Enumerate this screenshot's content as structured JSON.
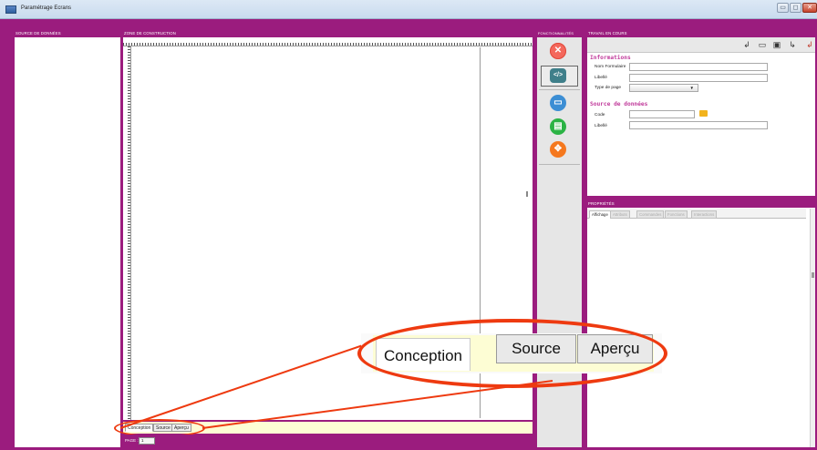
{
  "window": {
    "title": "Paramétrage Ecrans",
    "controls": {
      "minimize": "▭",
      "maximize": "◻",
      "close": "✕"
    }
  },
  "panels": {
    "source": {
      "header": "SOURCE DE DONNÉES"
    },
    "build": {
      "header": "ZONE DE CONSTRUCTION",
      "tabs": [
        "Conception",
        "Source",
        "Aperçu"
      ],
      "active_tab": "Conception",
      "page_label": "PAGE :",
      "page_value": "1"
    },
    "functions": {
      "header": "FONCTIONNALITÉS",
      "buttons": [
        {
          "name": "tools",
          "icon": "✕"
        },
        {
          "name": "code",
          "icon": "</>"
        },
        {
          "name": "screen",
          "icon": "▭"
        },
        {
          "name": "list",
          "icon": "▤"
        },
        {
          "name": "move",
          "icon": "✥"
        }
      ]
    },
    "work": {
      "header": "TRAVAIL EN COURS",
      "toolbar_icons": [
        "↲",
        "▭",
        "▣",
        "↳",
        "↲"
      ],
      "info_title": "Informations",
      "fields": {
        "nom_label": "Nom Formulaire",
        "nom_value": "",
        "libelle_label": "Libellé",
        "libelle_value": "",
        "type_label": "Type de page",
        "type_value": "",
        "type_caret": "▼"
      },
      "source_title": "Source de données",
      "source_fields": {
        "code_label": "Code",
        "code_value": "",
        "libelle_label": "Libellé",
        "libelle_value": ""
      }
    },
    "props": {
      "header": "PROPRIÉTÉS",
      "tabs": [
        "Affichage",
        "Attributs",
        "Commandes",
        "Fonctions",
        "Interactions"
      ],
      "active_tab": "Affichage"
    }
  },
  "callout": {
    "tabs": [
      "Conception",
      "Source",
      "Aperçu"
    ]
  },
  "colors": {
    "frame": "#9b1c7e",
    "section_title": "#c0399a",
    "highlight": "#ee3a10",
    "tab_strip": "#fdfdd4"
  }
}
